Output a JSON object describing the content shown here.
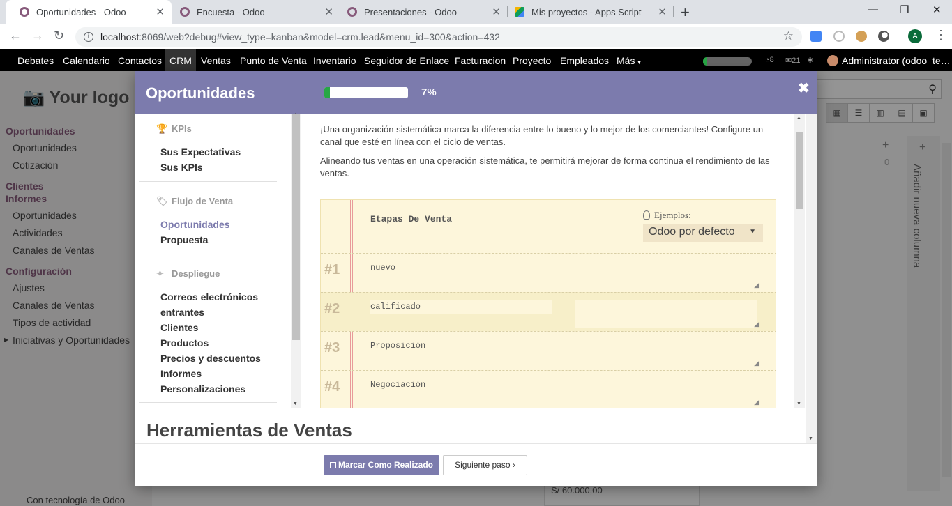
{
  "browser": {
    "tabs": [
      {
        "title": "Oportunidades - Odoo",
        "close": "✕"
      },
      {
        "title": "Encuesta - Odoo",
        "close": "✕"
      },
      {
        "title": "Presentaciones - Odoo",
        "close": "✕"
      },
      {
        "title": "Mis proyectos - Apps Script",
        "close": "✕"
      }
    ],
    "new_tab": "+",
    "url_host": "localhost",
    "url_path": ":8069/web?debug#view_type=kanban&model=crm.lead&menu_id=300&action=432",
    "profile_initial": "A"
  },
  "topbar": {
    "menus": [
      "Debates",
      "Calendario",
      "Contactos",
      "CRM",
      "Ventas",
      "Punto de Venta",
      "Inventario",
      "Seguidor de Enlace",
      "Facturacion",
      "Proyecto",
      "Empleados",
      "Más"
    ],
    "badge_chat": "8",
    "badge_msgs": "21",
    "user": "Administrator (odoo_te…"
  },
  "sidebar": {
    "logo": "Your logo",
    "sec1": "Oportunidades",
    "sec1_items": [
      "Oportunidades",
      "Cotización"
    ],
    "sec2a": "Clientes",
    "sec2b": "Informes",
    "sec2_items": [
      "Oportunidades",
      "Actividades",
      "Canales de Ventas"
    ],
    "sec3": "Configuración",
    "sec3_items": [
      "Ajustes",
      "Canales de Ventas",
      "Tipos de actividad",
      "Iniciativas y Oportunidades"
    ],
    "powered": "Con tecnología de Odoo"
  },
  "background": {
    "add_column": "Añadir nueva columna",
    "count": "0",
    "price": "S/ 60.000,00"
  },
  "modal": {
    "title": "Oportunidades",
    "progress_pct": 7,
    "progress_label": "7%",
    "nav": {
      "kpis": "KPIs",
      "kpi_items": [
        "Sus Expectativas",
        "Sus KPIs"
      ],
      "flujo": "Flujo de Venta",
      "flujo_items": [
        "Oportunidades",
        "Propuesta"
      ],
      "despliegue": "Despliegue",
      "despliegue_items": [
        "Correos electrónicos",
        "entrantes",
        "Clientes",
        "Productos",
        "Precios y descuentos",
        "Informes",
        "Personalizaciones"
      ]
    },
    "para1": "¡Una organización sistemática marca la diferencia entre lo bueno y lo mejor de los comerciantes! Configure un canal que esté en línea con el ciclo de ventas.",
    "para2": "Alineando tus ventas en una operación sistemática, te permitirá mejorar de forma continua el rendimiento de las ventas.",
    "notebook": {
      "title": "Etapas De Venta",
      "examples_label": "Ejemplos:",
      "examples_value": "Odoo por defecto",
      "rows": [
        {
          "num": "#1",
          "value": "nuevo"
        },
        {
          "num": "#2",
          "value": "calificado"
        },
        {
          "num": "#3",
          "value": "Proposición"
        },
        {
          "num": "#4",
          "value": "Negociación"
        }
      ]
    },
    "next_section": "Herramientas de Ventas",
    "btn_done": "Marcar Como Realizado",
    "btn_next": "Siguiente paso"
  }
}
